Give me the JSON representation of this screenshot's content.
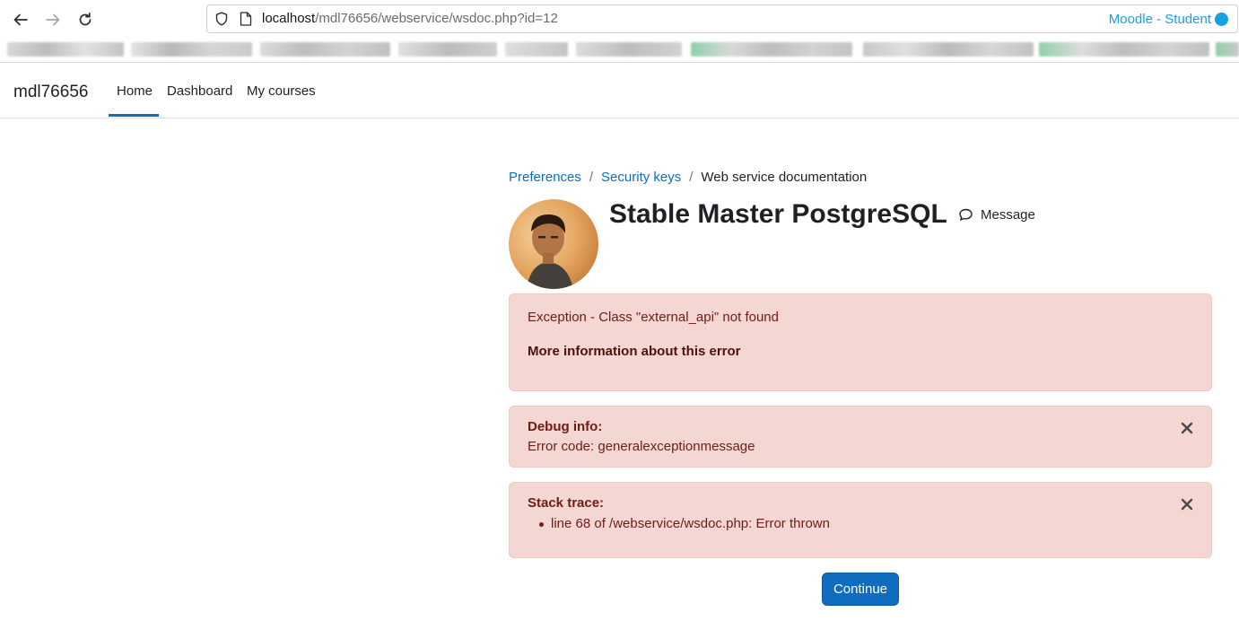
{
  "browser": {
    "url_host": "localhost",
    "url_path": "/mdl76656/webservice/wsdoc.php?id=12",
    "profile_label": "Moodle - Student",
    "profile_color": "#1a9fe0"
  },
  "navbar": {
    "brand": "mdl76656",
    "items": [
      {
        "label": "Home",
        "active": true
      },
      {
        "label": "Dashboard"
      },
      {
        "label": "My courses"
      }
    ],
    "accent_color": "#0f6cbf"
  },
  "breadcrumb": [
    {
      "label": "Preferences",
      "link": true
    },
    {
      "label": "Security keys",
      "link": true
    },
    {
      "label": "Web service documentation",
      "link": false
    }
  ],
  "header": {
    "title": "Stable Master PostgreSQL",
    "message_label": "Message"
  },
  "alerts": {
    "main": {
      "message": "Exception - Class \"external_api\" not found",
      "more_info": "More information about this error"
    },
    "debug": {
      "heading": "Debug info:",
      "text": "Error code: generalexceptionmessage"
    },
    "stack": {
      "heading": "Stack trace:",
      "items": [
        "line 68 of /webservice/wsdoc.php: Error thrown"
      ]
    }
  },
  "continue_label": "Continue",
  "icons": [
    "back-icon",
    "forward-icon",
    "reload-icon",
    "shield-icon",
    "page-icon",
    "speech-bubble-icon",
    "close-icon"
  ]
}
